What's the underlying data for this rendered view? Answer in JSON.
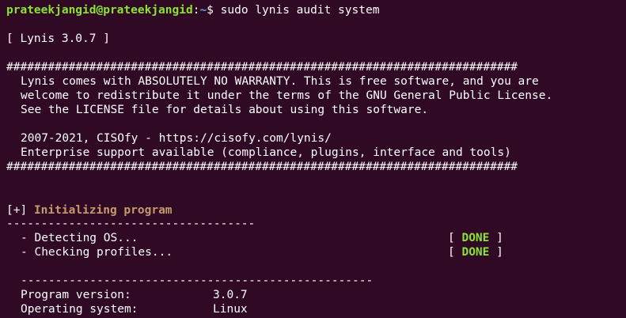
{
  "terminal": {
    "prompt": {
      "user_host": "prateekjangid@prateekjangid",
      "separator": ":",
      "path": "~",
      "symbol": "$",
      "command": "sudo lynis audit system"
    },
    "banner": "[ Lynis 3.0.7 ]",
    "hash_line": "##########################################################################",
    "warranty_lines": [
      "Lynis comes with ABSOLUTELY NO WARRANTY. This is free software, and you are",
      "welcome to redistribute it under the terms of the GNU General Public License.",
      "See the LICENSE file for details about using this software."
    ],
    "info_lines": [
      "2007-2021, CISOfy - https://cisofy.com/lynis/",
      "Enterprise support available (compliance, plugins, interface and tools)"
    ],
    "section": {
      "marker": "[+]",
      "title": "Initializing program",
      "underline": "------------------------------------"
    },
    "checks": [
      {
        "label": "- Detecting OS...",
        "status": "DONE"
      },
      {
        "label": "- Checking profiles...",
        "status": "DONE"
      }
    ],
    "divider": "---------------------------------------------------",
    "details": [
      {
        "label": "Program version:",
        "value": "3.0.7"
      },
      {
        "label": "Operating system:",
        "value": "Linux"
      }
    ]
  }
}
